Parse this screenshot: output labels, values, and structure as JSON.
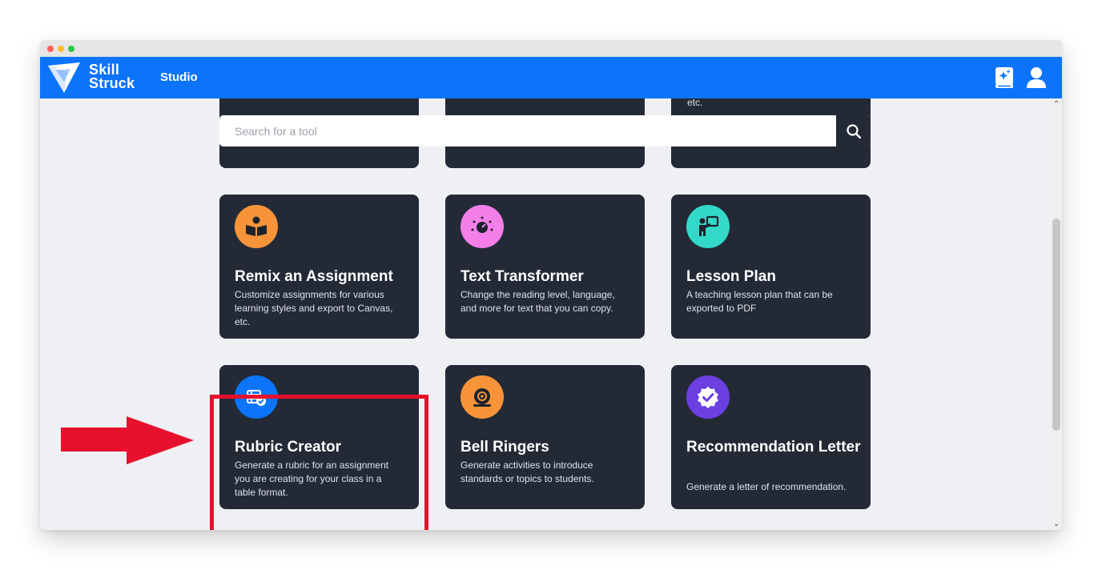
{
  "app": {
    "brand_line1": "Skill",
    "brand_line2": "Struck",
    "section": "Studio",
    "brand_color": "#0b74fa"
  },
  "header_icons": [
    "ai-book-icon",
    "user-icon"
  ],
  "search": {
    "placeholder": "Search for a tool",
    "button_icon": "search-icon"
  },
  "partial_row": {
    "cards": [
      {
        "desc_tail": ""
      },
      {
        "desc_tail": ""
      },
      {
        "desc_tail": "etc."
      }
    ]
  },
  "tools": [
    {
      "title": "Remix an Assignment",
      "desc": "Customize assignments for various learning styles and export to Canvas, etc.",
      "icon": "reading-person-icon",
      "color": "#f7943a"
    },
    {
      "title": "Text Transformer",
      "desc": "Change the reading level, language, and more for text that you can copy.",
      "icon": "sparkle-dial-icon",
      "color": "#f47fe9"
    },
    {
      "title": "Lesson Plan",
      "desc": "A teaching lesson plan that can be exported to PDF",
      "icon": "teacher-board-icon",
      "color": "#32d9c9"
    },
    {
      "title": "Rubric Creator",
      "desc": "Generate a rubric for an assignment you are creating for your class in a table format.",
      "icon": "rubric-table-icon",
      "color": "#0b74fa"
    },
    {
      "title": "Bell Ringers",
      "desc": "Generate activities to introduce standards or topics to students.",
      "icon": "bell-icon",
      "color": "#f7943a"
    },
    {
      "title": "Recommendation Letter",
      "desc": "Generate a letter of recommendation.",
      "icon": "badge-check-icon",
      "color": "#6b3fe0"
    }
  ],
  "annotation": {
    "highlighted_tool": "Rubric Creator",
    "highlight_color": "#e8112d"
  }
}
